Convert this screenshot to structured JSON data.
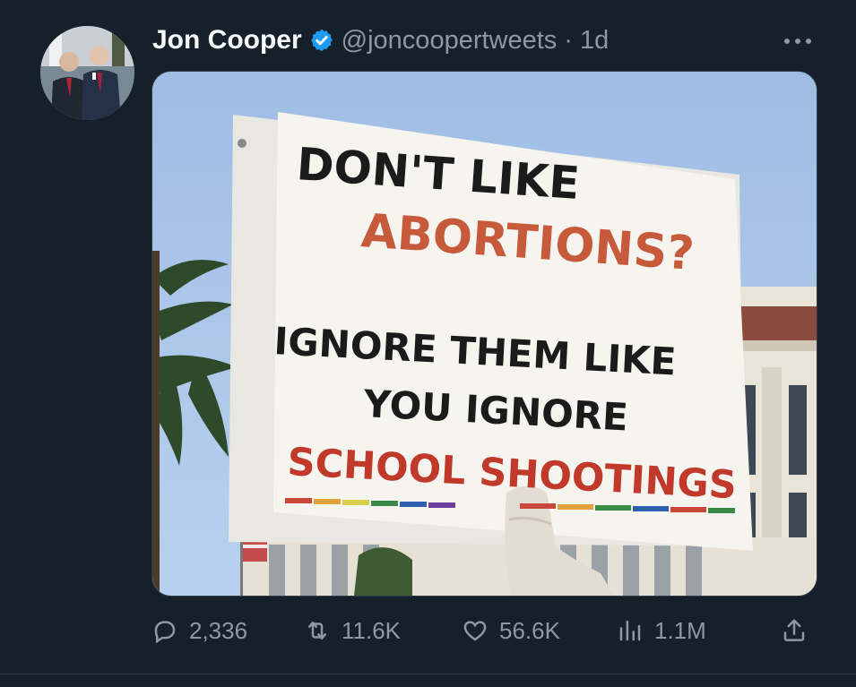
{
  "tweet": {
    "author_name": "Jon Cooper",
    "handle": "@joncoopertweets",
    "separator": "·",
    "time": "1d",
    "more_icon": "more-horizontal-icon",
    "verified": true
  },
  "sign": {
    "line1": "DON'T LIKE",
    "line2": "ABORTIONS?",
    "line3": "IGNORE THEM LIKE",
    "line4": "YOU IGNORE",
    "line5": "SCHOOL SHOOTINGS"
  },
  "actions": {
    "replies": "2,336",
    "retweets": "11.6K",
    "likes": "56.6K",
    "views": "1.1M"
  },
  "colors": {
    "background": "#15202b",
    "secondary_text": "#8b98a5",
    "verified_blue": "#1d9bf0",
    "sign_red": "#c0392b"
  }
}
